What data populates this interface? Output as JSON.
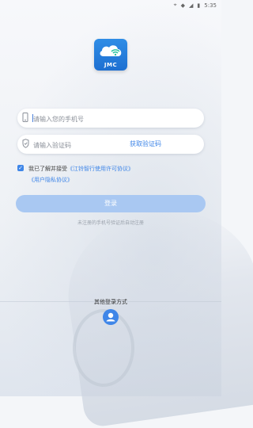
{
  "status_bar": {
    "time": "5:35"
  },
  "logo": {
    "text": "JMC",
    "accent": "#2f8de6"
  },
  "phone_field": {
    "placeholder": "请输入您的手机号",
    "icon": "phone-icon"
  },
  "code_field": {
    "placeholder": "请输入验证码",
    "get_code_label": "获取验证码",
    "icon": "shield-icon"
  },
  "agreement": {
    "checked": true,
    "prefix": "我已了解并接受",
    "license_link": "《江铃智行使用许可协议》",
    "privacy_link": "《用户隐私协议》"
  },
  "login_button": {
    "label": "登录",
    "color": "#a9c8f2"
  },
  "hint": {
    "text": "未注册的手机号验证后自动注册"
  },
  "other_login": {
    "label": "其他登录方式",
    "icon": "user-avatar-icon"
  }
}
